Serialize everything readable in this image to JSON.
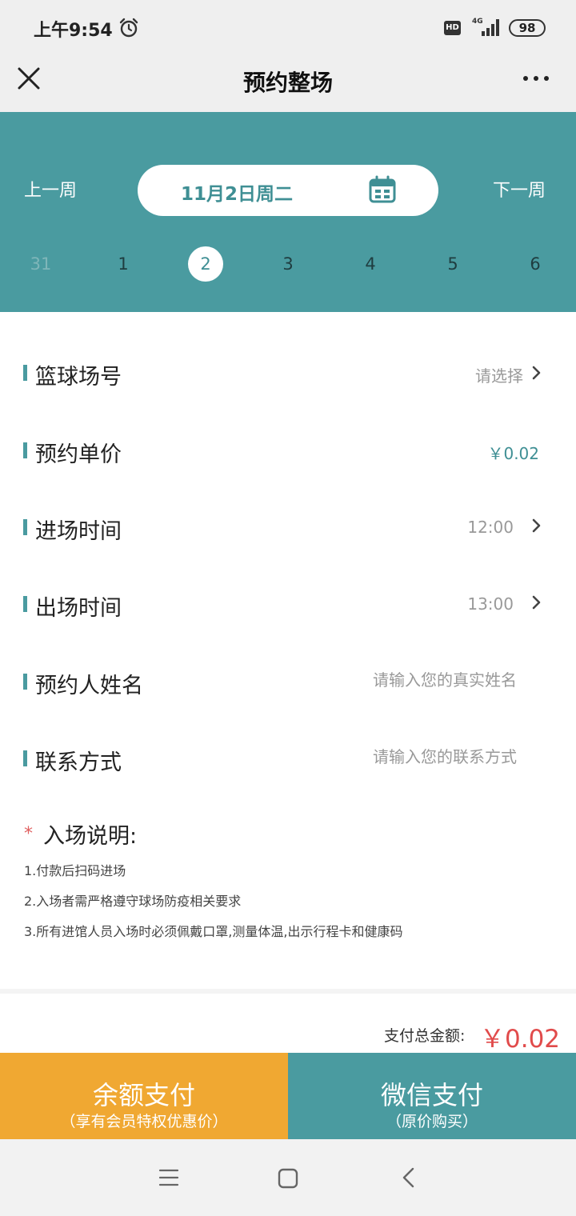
{
  "status_bar": {
    "time": "上午9:54",
    "hd_badge": "HD",
    "network": "4G",
    "battery": "98"
  },
  "nav": {
    "title": "预约整场"
  },
  "date_header": {
    "prev_week": "上一周",
    "next_week": "下一周",
    "current_date": "11月2日周二",
    "days": [
      "31",
      "1",
      "2",
      "3",
      "4",
      "5",
      "6"
    ],
    "selected_day": "2"
  },
  "form": {
    "court": {
      "label": "篮球场号",
      "value": "请选择"
    },
    "unit_price": {
      "label": "预约单价",
      "value": "￥0.02"
    },
    "entry_time": {
      "label": "进场时间",
      "value": "12:00"
    },
    "exit_time": {
      "label": "出场时间",
      "value": "13:00"
    },
    "name": {
      "label": "预约人姓名",
      "placeholder": "请输入您的真实姓名"
    },
    "contact": {
      "label": "联系方式",
      "placeholder": "请输入您的联系方式"
    }
  },
  "instructions": {
    "star": "*",
    "title": "入场说明:",
    "lines": [
      "1.付款后扫码进场",
      "2.入场者需严格遵守球场防疫相关要求",
      "3.所有进馆人员入场时必须佩戴口罩,测量体温,出示行程卡和健康码"
    ]
  },
  "payment": {
    "total_label": "支付总金额:",
    "total_amount": "￥0.02",
    "balance_pay": {
      "title": "余额支付",
      "subtitle": "（享有会员特权优惠价）"
    },
    "wechat_pay": {
      "title": "微信支付",
      "subtitle": "（原价购买）"
    }
  },
  "colors": {
    "primary": "#4a9ba0",
    "accent_orange": "#f0a832",
    "price_red": "#e14b4b"
  }
}
